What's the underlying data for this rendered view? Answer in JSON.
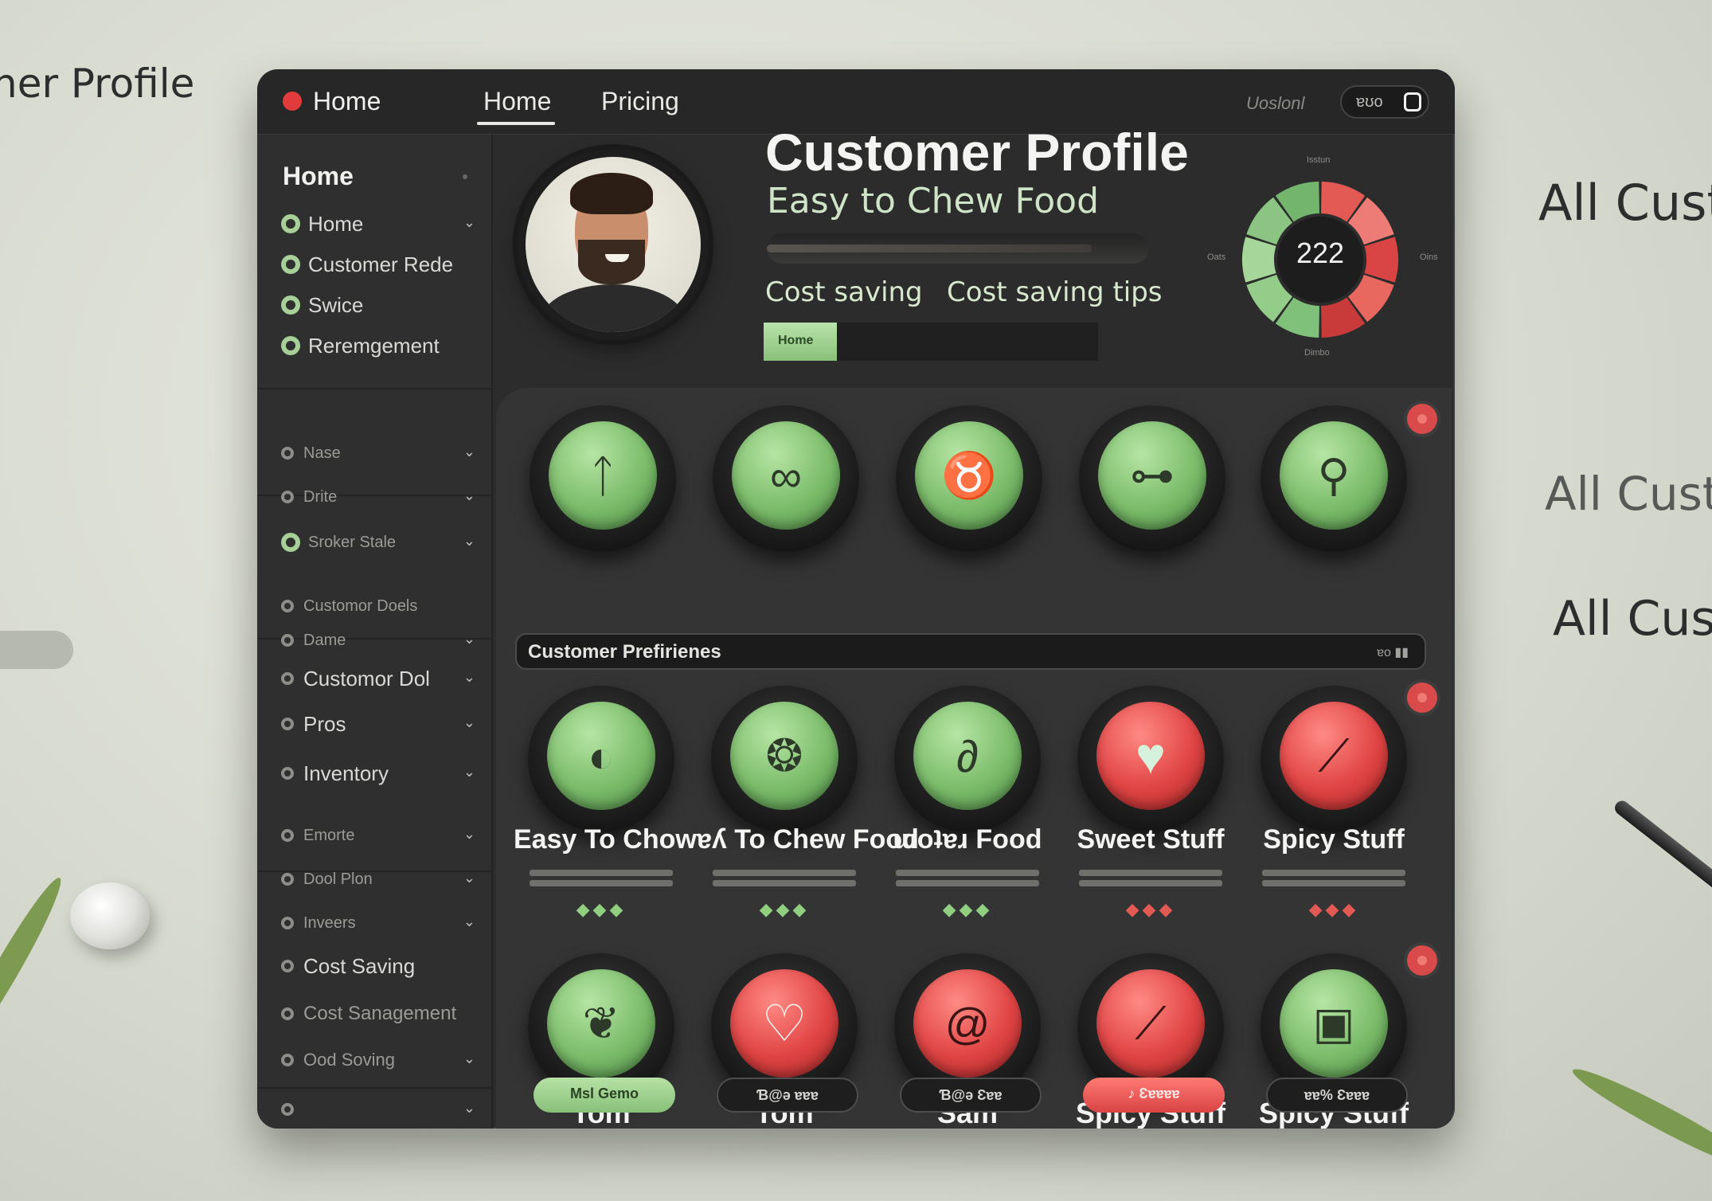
{
  "background": {
    "left_title": "ner Profile",
    "right_texts": [
      "All Cust",
      "All Custo",
      "All Cust"
    ]
  },
  "topbar": {
    "brand_label": "Home",
    "nav": [
      "Home",
      "Pricing"
    ],
    "active_nav": "Home",
    "user_label": "Uoslonl",
    "toggle_label": "ɐʊo"
  },
  "sidebar": {
    "title": "Home",
    "primary_items": [
      "Home",
      "Customer Rede",
      "Swice",
      "Reremgement"
    ],
    "group_a": [
      "Nase",
      "Drite",
      "Sroker Stale"
    ],
    "group_b": [
      "Customor Doels",
      "Dame",
      "Customor Dol",
      "Pros",
      "Inventory"
    ],
    "group_c": [
      "Emorte",
      "Dool Plon",
      "Inveers",
      "Cost Saving",
      "Cost Sanagement",
      "Ood Soving",
      ""
    ]
  },
  "hero": {
    "title": "Customer Profile",
    "subtitle": "Easy to Chew Food",
    "bar_fill_fraction": 0.85,
    "links": [
      "Cost saving",
      "Cost saving tips"
    ],
    "progress_label": "Home",
    "progress_fraction": 0.22
  },
  "gauge": {
    "value": "222",
    "label_top": "Isstun",
    "label_left": "Oats",
    "label_right": "Oins",
    "label_bottom": "Dimbo",
    "segments_green": 5,
    "segments_red": 5
  },
  "preferences": {
    "header": "Customer Prefirienes",
    "header_ctrl": "ɐo ▮▮",
    "top_row_icons": [
      "fork-icon",
      "pretzel-icon",
      "utensils-icon",
      "bone-icon",
      "whisk-icon"
    ],
    "cards": [
      {
        "title": "Easy To Chow",
        "color": "green",
        "icon": "olive-icon",
        "gems": "◆◆◆"
      },
      {
        "title": "ɐʎ To Chew Food",
        "color": "green",
        "icon": "apple-icon",
        "gems": "◆◆◆"
      },
      {
        "title": "ɯoʇɐɹ Food",
        "color": "green",
        "icon": "bean-icon",
        "gems": "◆◆◆"
      },
      {
        "title": "Sweet Stuff",
        "color": "red",
        "icon": "heart-icon",
        "gems": "◆◆◆"
      },
      {
        "title": "Spicy Stuff",
        "color": "red",
        "icon": "pepper-icon",
        "gems": "◆◆◆"
      }
    ],
    "people": [
      {
        "name": "Tom",
        "color": "green",
        "icon": "leaf-icon",
        "pill": "Msl Gemo",
        "pill_style": "green"
      },
      {
        "name": "Tom",
        "color": "red",
        "icon": "heart-icon",
        "pill": "Ɓ@ə ɐɐɐ",
        "pill_style": "dark"
      },
      {
        "name": "Sam",
        "color": "red",
        "icon": "snail-icon",
        "pill": "Ɓ@ə Ɛɐɐ",
        "pill_style": "dark"
      },
      {
        "name": "Spicy Stuff",
        "color": "red",
        "icon": "pepper-icon",
        "pill": "♪ Ɛɐɐɐɐ",
        "pill_style": "red"
      },
      {
        "name": "Spicy Stuff",
        "color": "green",
        "icon": "tablet-icon",
        "pill": "ɐɐ% Ɛɐɐɐ",
        "pill_style": "dark"
      }
    ]
  },
  "colors": {
    "accent_green": "#7bbc6a",
    "accent_red": "#e04444",
    "window_bg": "#2b2c2b"
  }
}
